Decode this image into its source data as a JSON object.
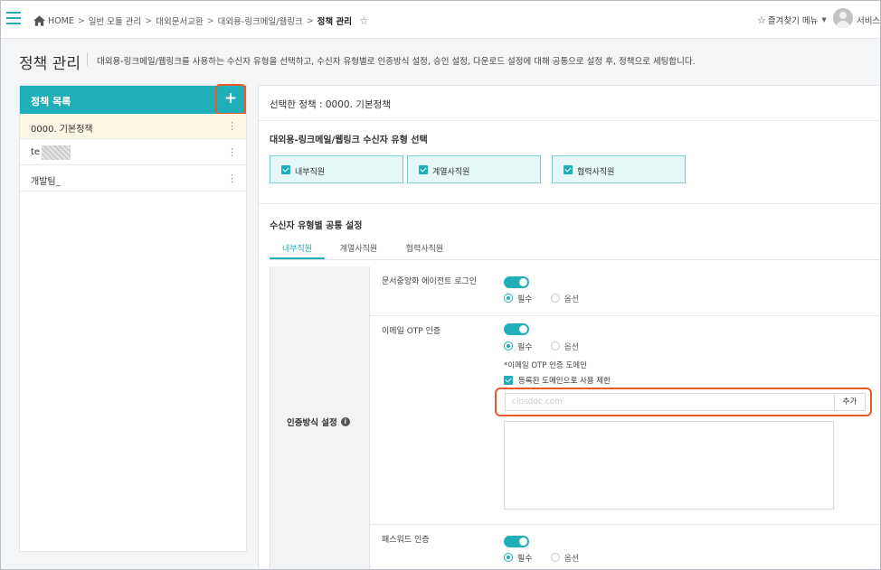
{
  "topbar": {
    "breadcrumbs": [
      "HOME",
      "일반 모듈 관리",
      "대외문서교환",
      "대외용-링크메일/웹링크"
    ],
    "current": "정책 관리",
    "favorites_label": "즐겨찾기 메뉴",
    "user_name": "서비스리"
  },
  "page": {
    "title": "정책 관리",
    "description": "대외용-링크메일/웹링크를 사용하는 수신자 유형을 선택하고, 수신자 유형별로 인증방식 설정, 승인 설정, 다운로드 설정에 대해 공통으로 설정 후, 정책으로 세팅합니다."
  },
  "policy_list": {
    "title": "정책 목록",
    "add_label": "+",
    "items": [
      {
        "label": "0000. 기본정책"
      },
      {
        "label": "te"
      },
      {
        "label": "개발팀_"
      }
    ]
  },
  "detail": {
    "selected_policy": "선택한 정책 : 0000. 기본정책",
    "recipient_section_title": "대외용-링크메일/웹링크 수신자 유형 선택",
    "recipient_types": [
      "내부직원",
      "계열사직원",
      "협력사직원"
    ],
    "common_section_title": "수신자 유형별 공통 설정",
    "tabs": [
      "내부직원",
      "계열사직원",
      "협력사직원"
    ],
    "auth_label": "인증방식 설정",
    "rows": [
      {
        "label": "문서중앙화 에이전트 로그인",
        "required": "필수",
        "optional": "옵션"
      },
      {
        "label": "이메일 OTP 인증",
        "required": "필수",
        "optional": "옵션"
      },
      {
        "label": "패스워드 인증",
        "required": "필수",
        "optional": "옵션"
      }
    ],
    "otp_note": "*이메일 OTP 인증 도메인",
    "restrict_label": "등록된 도메인으로 사용 제한",
    "domain_placeholder": "closdoc.com",
    "domain_add_label": "추가"
  }
}
